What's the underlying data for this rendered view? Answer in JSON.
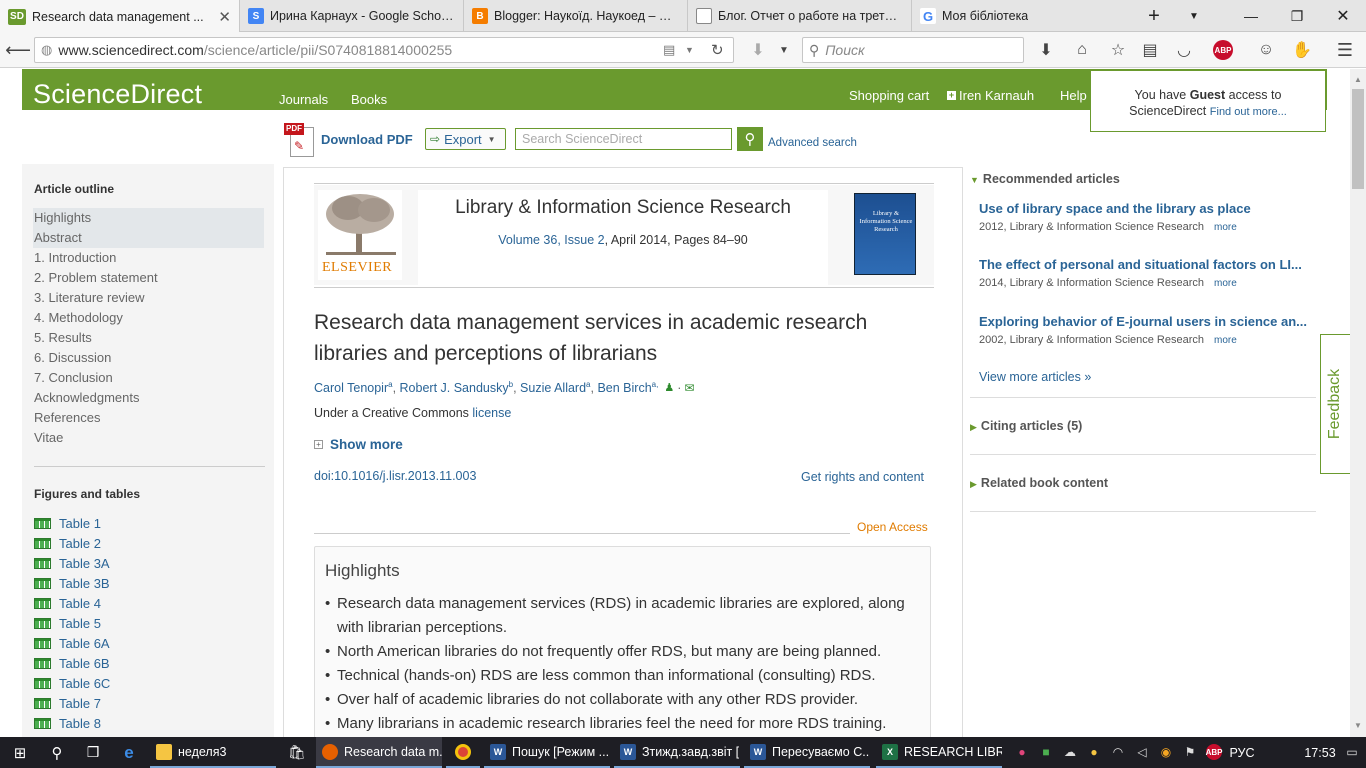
{
  "browser": {
    "tabs": [
      {
        "favicon": "SD",
        "favicon_color": "#6a9a2e",
        "title": "Research data management ..."
      },
      {
        "favicon": "S",
        "favicon_color": "#4285f4",
        "title": "Ирина Карнаух - Google Scholar ..."
      },
      {
        "favicon": "B",
        "favicon_color": "#f57d00",
        "title": "Blogger: Наукоїд. Наукоед – Изм..."
      },
      {
        "favicon": "",
        "favicon_color": "#888888",
        "title": "Блог. Отчет о работе на третьей..."
      },
      {
        "favicon": "G",
        "favicon_color": "#4285f4",
        "title": "Моя бібліотека"
      }
    ],
    "new_tab": "+",
    "url_domain": "www.sciencedirect.com",
    "url_path": "/science/article/pii/S0740818814000255",
    "search_placeholder": "Поиск",
    "abp": "ABP"
  },
  "sd": {
    "logo": "ScienceDirect",
    "nav": [
      "Journals",
      "Books"
    ],
    "shopping_cart": "Shopping cart",
    "user": "Iren Karnauh",
    "help": "Help",
    "guest_1": "You have",
    "guest_bold": "Guest",
    "guest_2": "access to",
    "guest_3": "ScienceDirect",
    "guest_link": "Find out more...",
    "download_pdf": "Download PDF",
    "pdf_badge": "PDF",
    "export": "Export",
    "search_placeholder": "Search ScienceDirect",
    "advanced_search": "Advanced search"
  },
  "outline": {
    "title": "Article outline",
    "items": [
      "Highlights",
      "Abstract",
      "1. Introduction",
      "2. Problem statement",
      "3. Literature review",
      "4. Methodology",
      "5. Results",
      "6. Discussion",
      "7. Conclusion",
      "Acknowledgments",
      "References",
      "Vitae"
    ],
    "figures_title": "Figures and tables",
    "figures": [
      "Table 1",
      "Table 2",
      "Table 3A",
      "Table 3B",
      "Table 4",
      "Table 5",
      "Table 6A",
      "Table 6B",
      "Table 6C",
      "Table 7",
      "Table 8"
    ]
  },
  "article": {
    "publisher": "ELSEVIER",
    "journal": "Library & Information Science Research",
    "volume_link": "Volume 36, Issue 2",
    "volume_rest": ", April 2014, Pages 84–90",
    "cover_text": "Library & Information Science Research",
    "title": "Research data management services in academic research libraries and perceptions of librarians",
    "authors": [
      {
        "name": "Carol Tenopir",
        "sup": "a"
      },
      {
        "name": "Robert J. Sandusky",
        "sup": "b"
      },
      {
        "name": "Suzie Allard",
        "sup": "a"
      },
      {
        "name": "Ben Birch",
        "sup": "a,"
      }
    ],
    "license_pre": "Under a Creative Commons",
    "license_link": "license",
    "show_more": "Show more",
    "doi": "doi:10.1016/j.lisr.2013.11.003",
    "rights": "Get rights and content",
    "open_access": "Open Access",
    "highlights_title": "Highlights",
    "highlights": [
      "Research data management services (RDS) in academic libraries are explored, along with librarian perceptions.",
      "North American libraries do not frequently offer RDS, but many are being planned.",
      "Technical (hands-on) RDS are less common than informational (consulting) RDS.",
      "Over half of academic libraries do not collaborate with any other RDS provider.",
      "Many librarians in academic research libraries feel the need for more RDS training."
    ]
  },
  "right": {
    "recommended": "Recommended articles",
    "articles": [
      {
        "title": "Use of library space and the library as place",
        "meta": "2012, Library & Information Science Research"
      },
      {
        "title": "The effect of personal and situational factors on LI...",
        "meta": "2014, Library & Information Science Research"
      },
      {
        "title": "Exploring behavior of E-journal users in science an...",
        "meta": "2002, Library & Information Science Research"
      }
    ],
    "more": "more",
    "view_more": "View more articles »",
    "citing": "Citing articles (5)",
    "related": "Related book content",
    "feedback": "Feedback"
  },
  "taskbar": {
    "items": [
      {
        "label": "неделя3",
        "icon_color": "#f5c542"
      },
      {
        "label": "Research data m...",
        "icon_color": "#e66000"
      },
      {
        "label": "",
        "icon_color": "#db4437"
      },
      {
        "label": "Пошук [Режим ...",
        "icon_color": "#2b5797"
      },
      {
        "label": "Зтижд.завд.звіт [...",
        "icon_color": "#2b5797"
      },
      {
        "label": "Пересуваємо С...",
        "icon_color": "#2b5797"
      },
      {
        "label": "RESEARCH LIBR...",
        "icon_color": "#1e7145"
      }
    ],
    "lang": "РУС",
    "time": "17:53"
  },
  "colors": {
    "brand_green": "#6a9a2e",
    "link_blue": "#2a6496",
    "open_access_orange": "#e07b00"
  }
}
